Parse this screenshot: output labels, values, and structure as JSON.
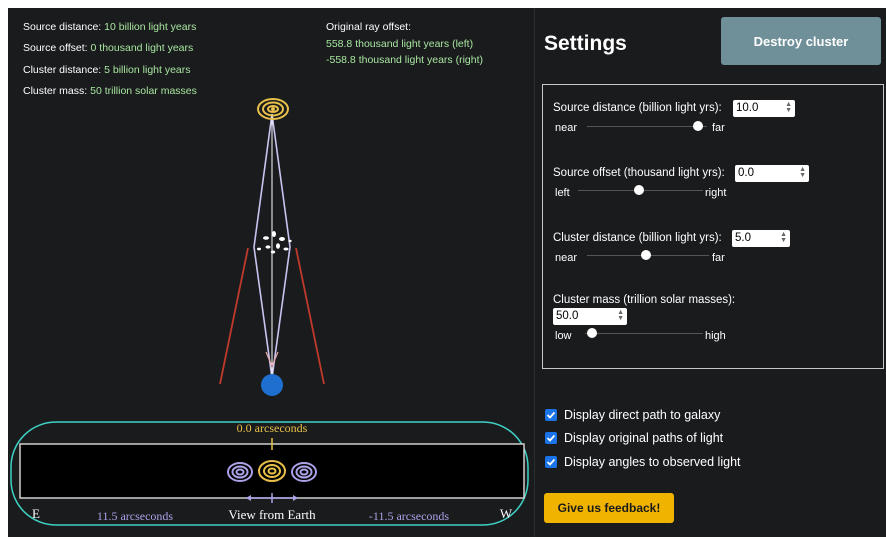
{
  "info": {
    "source_distance_label": "Source distance:",
    "source_distance_value": "10 billion light years",
    "source_offset_label": "Source offset:",
    "source_offset_value": "0 thousand light years",
    "cluster_distance_label": "Cluster distance:",
    "cluster_distance_value": "5 billion light years",
    "cluster_mass_label": "Cluster mass:",
    "cluster_mass_value": "50 trillion solar masses",
    "ray_offset_title": "Original ray offset:",
    "ray_offset_left": "558.8 thousand light years (left)",
    "ray_offset_right": "-558.8 thousand light years (right)"
  },
  "view": {
    "center_angle": "0.0 arcseconds",
    "left_angle": "11.5 arcseconds",
    "right_angle": "-11.5 arcseconds",
    "caption": "View from Earth",
    "east": "E",
    "west": "W"
  },
  "settings": {
    "title": "Settings",
    "destroy_label": "Destroy cluster",
    "source_distance": {
      "label": "Source distance (billion light yrs):",
      "value": "10.0",
      "low": "near",
      "high": "far",
      "level": 0.9
    },
    "source_offset": {
      "label": "Source offset (thousand light yrs):",
      "value": "0.0",
      "low": "left",
      "high": "right",
      "level": 0.5
    },
    "cluster_distance": {
      "label": "Cluster distance (billion light yrs):",
      "value": "5.0",
      "low": "near",
      "high": "far",
      "level": 0.5
    },
    "cluster_mass": {
      "label": "Cluster mass (trillion solar masses):",
      "value": "50.0",
      "low": "low",
      "high": "high",
      "level": 0.05
    }
  },
  "options": [
    {
      "label": "Display direct path to galaxy",
      "checked": true
    },
    {
      "label": "Display original paths of light",
      "checked": true
    },
    {
      "label": "Display angles to observed light",
      "checked": true
    }
  ],
  "feedback_label": "Give us feedback!",
  "colors": {
    "background": "#1a1b1d",
    "info_value": "#a8e6a0",
    "ray": "#c9c4f0",
    "angle_line": "#c0392b",
    "galaxy": "#e8c04a",
    "image_galaxy": "#a9a2e6",
    "earth": "#1f6fd1",
    "highlight_oval": "#3fd1c4",
    "feedback": "#f0b400",
    "destroy_button": "#6f8f99"
  }
}
